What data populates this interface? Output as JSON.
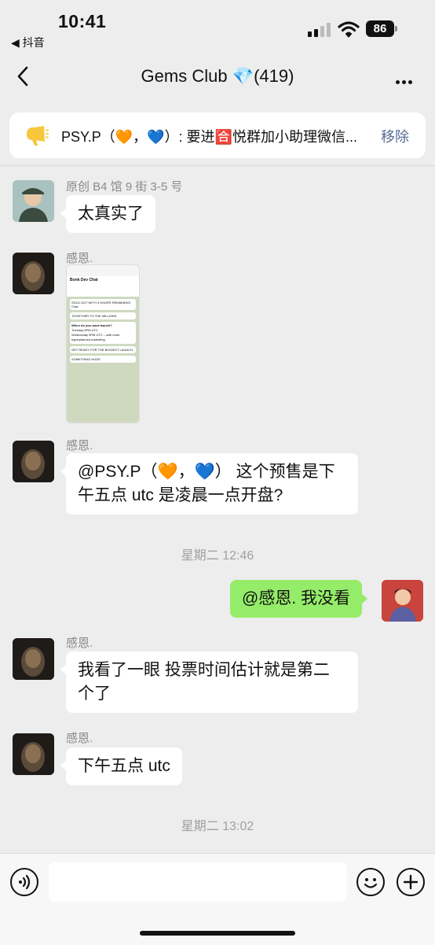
{
  "status_bar": {
    "time": "10:41",
    "back_app": "◀ 抖音",
    "battery": "86"
  },
  "nav": {
    "title": "Gems Club 💎(419)"
  },
  "pinned": {
    "text": "PSY.P（🧡，💙）: 要进🈴悦群加小助理微信...",
    "action": "移除"
  },
  "messages": [
    {
      "nick": "原创 B4 馆 9 街 3-5 号",
      "text": "太真实了"
    },
    {
      "nick": "感恩.",
      "image": {
        "header": "Bonk Dev Chat",
        "lines": [
          "SOLD OUT WITH 4 HOURS REMAINING! Chat",
          "TOGETHER TO THE MILLIONS",
          "When do you want launch?",
          "Tuesday 5PM UTC",
          "Wednesday 5PM UTC – with more hype/planned marketing",
          "GET READY FOR THE BIGGEST LAUNCH.",
          "SOMETHING HUGE"
        ]
      }
    },
    {
      "nick": "感恩.",
      "text_line1": "@PSY.P（🧡，💙） 这个预售是下",
      "text_line2": "午五点 utc  是凌晨一点开盘?"
    },
    {
      "me": true,
      "text": "@感恩. 我没看"
    },
    {
      "nick": "感恩.",
      "text_line1": "我看了一眼 投票时间估计就是第二",
      "text_line2": "个了"
    },
    {
      "nick": "感恩.",
      "text": "下午五点 utc"
    }
  ],
  "timestamps": [
    "星期二 12:46",
    "星期二 13:02"
  ],
  "icons": {
    "voice": "voice-icon",
    "emoji": "emoji-icon",
    "plus": "plus-icon"
  }
}
